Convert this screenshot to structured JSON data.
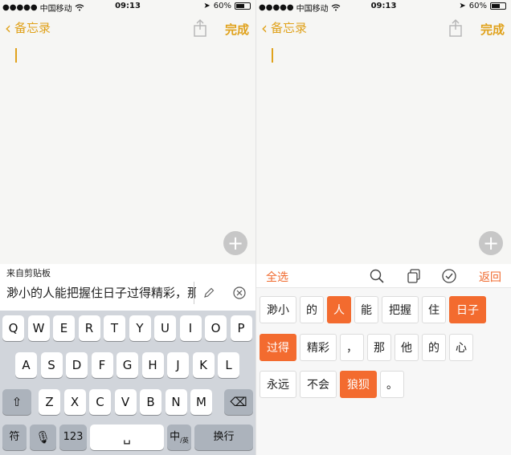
{
  "status": {
    "carrier": "中国移动",
    "time": "09:13",
    "battery": "60%",
    "battery_level": 0.6
  },
  "nav": {
    "back_label": "备忘录",
    "done_label": "完成"
  },
  "clipboard": {
    "title": "来自剪贴板",
    "text": "渺小的人能把握住日子过得精彩，那他的心永远不会狼狈。"
  },
  "keyboard": {
    "row1": [
      "Q",
      "W",
      "E",
      "R",
      "T",
      "Y",
      "U",
      "I",
      "O",
      "P"
    ],
    "row2": [
      "A",
      "S",
      "D",
      "F",
      "G",
      "H",
      "J",
      "K",
      "L"
    ],
    "row3": [
      "Z",
      "X",
      "C",
      "V",
      "B",
      "N",
      "M"
    ],
    "symbol_key": "符",
    "num_key": "123",
    "lang_key": "中",
    "lang_sub": "英",
    "return_key": "换行"
  },
  "editbar": {
    "select_all": "全选",
    "back": "返回"
  },
  "tokens": [
    {
      "text": "渺小",
      "selected": false
    },
    {
      "text": "的",
      "selected": false
    },
    {
      "text": "人",
      "selected": true
    },
    {
      "text": "能",
      "selected": false
    },
    {
      "text": "把握",
      "selected": false
    },
    {
      "text": "住",
      "selected": false
    },
    {
      "text": "日子",
      "selected": true
    },
    {
      "text": "过得",
      "selected": true
    },
    {
      "text": "精彩",
      "selected": false
    },
    {
      "text": "，",
      "selected": false
    },
    {
      "text": "那",
      "selected": false
    },
    {
      "text": "他",
      "selected": false
    },
    {
      "text": "的",
      "selected": false
    },
    {
      "text": "心",
      "selected": false
    },
    {
      "text": "永远",
      "selected": false
    },
    {
      "text": "不会",
      "selected": false
    },
    {
      "text": "狼狈",
      "selected": true
    },
    {
      "text": "。",
      "selected": false
    }
  ],
  "colors": {
    "accent": "#e0a21c",
    "token_selected": "#f36b2f"
  },
  "icons": [
    "back-chevron-icon",
    "share-icon",
    "plus-icon",
    "pencil-icon",
    "clear-icon",
    "shift-icon",
    "delete-icon",
    "mic-icon",
    "search-icon",
    "copy-icon",
    "check-icon",
    "wifi-icon",
    "location-icon",
    "battery-icon"
  ]
}
